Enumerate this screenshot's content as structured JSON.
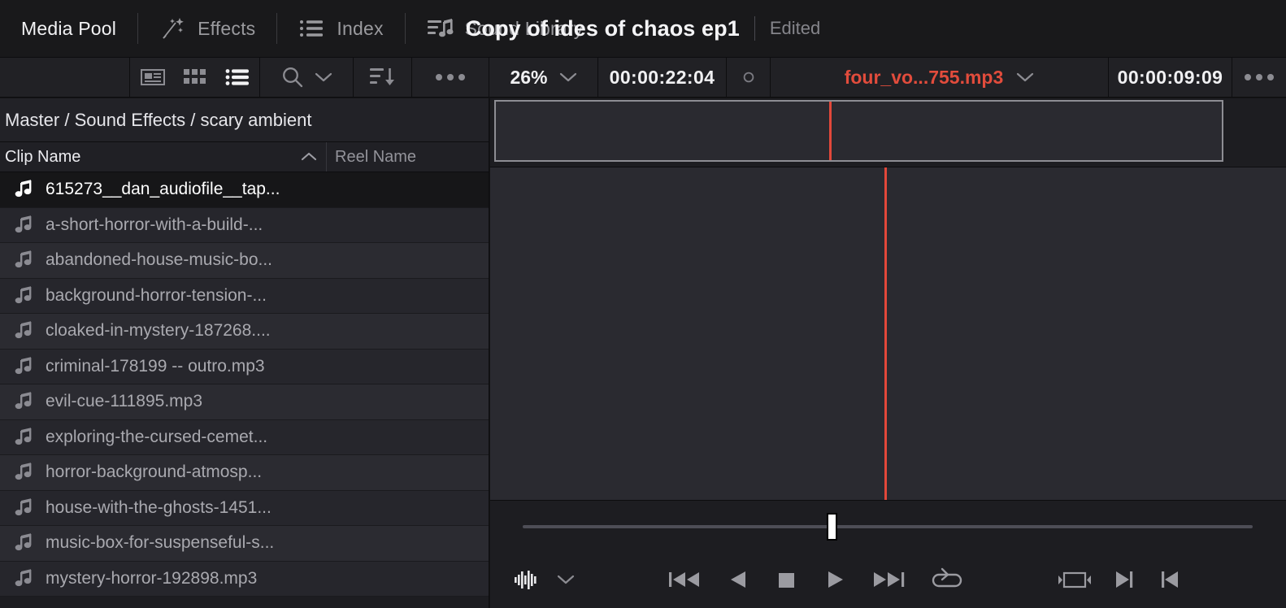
{
  "titlebar": {
    "tabs": [
      {
        "label": "Media Pool",
        "icon": "none",
        "active": true
      },
      {
        "label": "Effects",
        "icon": "magic-wand-icon",
        "active": false
      },
      {
        "label": "Index",
        "icon": "list-index-icon",
        "active": false
      },
      {
        "label": "Sound Library",
        "icon": "sound-library-icon",
        "active": false
      }
    ],
    "project_title": "Copy of ides of chaos ep1",
    "project_status": "Edited"
  },
  "toolbar": {
    "view_buttons": [
      {
        "name": "metadata-view-icon",
        "active": false
      },
      {
        "name": "thumbnail-view-icon",
        "active": false
      },
      {
        "name": "list-view-icon",
        "active": true
      }
    ],
    "search_icon": "search-icon",
    "search_chevron": "chevron-down-icon",
    "sort_icon": "sort-descending-icon",
    "more_icon": "more-options-icon",
    "zoom_level": "26%",
    "zoom_chevron": "chevron-down-icon",
    "timecode_left": "00:00:22:04",
    "record_icon": "record-circle-icon",
    "clip_name": "four_vo...755.mp3",
    "clip_chevron": "chevron-down-icon",
    "timecode_right": "00:00:09:09",
    "more_icon_2": "more-options-icon",
    "accent_red": "#e24c3c"
  },
  "media_pool": {
    "breadcrumb": "Master / Sound Effects / scary ambient",
    "columns": [
      {
        "label": "Clip Name",
        "sort": "ascending"
      },
      {
        "label": "Reel Name",
        "sort": "none"
      }
    ],
    "clips": [
      {
        "name": "615273__dan_audiofile__tap...",
        "selected": true
      },
      {
        "name": "a-short-horror-with-a-build-...",
        "selected": false
      },
      {
        "name": "abandoned-house-music-bo...",
        "selected": false
      },
      {
        "name": "background-horror-tension-...",
        "selected": false
      },
      {
        "name": "cloaked-in-mystery-187268....",
        "selected": false
      },
      {
        "name": "criminal-178199 -- outro.mp3",
        "selected": false
      },
      {
        "name": "evil-cue-111895.mp3",
        "selected": false
      },
      {
        "name": "exploring-the-cursed-cemet...",
        "selected": false
      },
      {
        "name": "horror-background-atmosp...",
        "selected": false
      },
      {
        "name": "house-with-the-ghosts-1451...",
        "selected": false
      },
      {
        "name": "music-box-for-suspenseful-s...",
        "selected": false
      },
      {
        "name": "mystery-horror-192898.mp3",
        "selected": false
      }
    ]
  },
  "viewer": {
    "transport": [
      {
        "name": "audio-waveform-icon"
      },
      {
        "name": "chevron-down-icon"
      },
      {
        "name": "jump-to-start-button"
      },
      {
        "name": "play-reverse-button"
      },
      {
        "name": "stop-button"
      },
      {
        "name": "play-button"
      },
      {
        "name": "jump-to-end-button"
      },
      {
        "name": "loop-button"
      },
      {
        "name": "in-out-range-button"
      },
      {
        "name": "mark-out-button"
      },
      {
        "name": "mark-in-button"
      }
    ]
  }
}
